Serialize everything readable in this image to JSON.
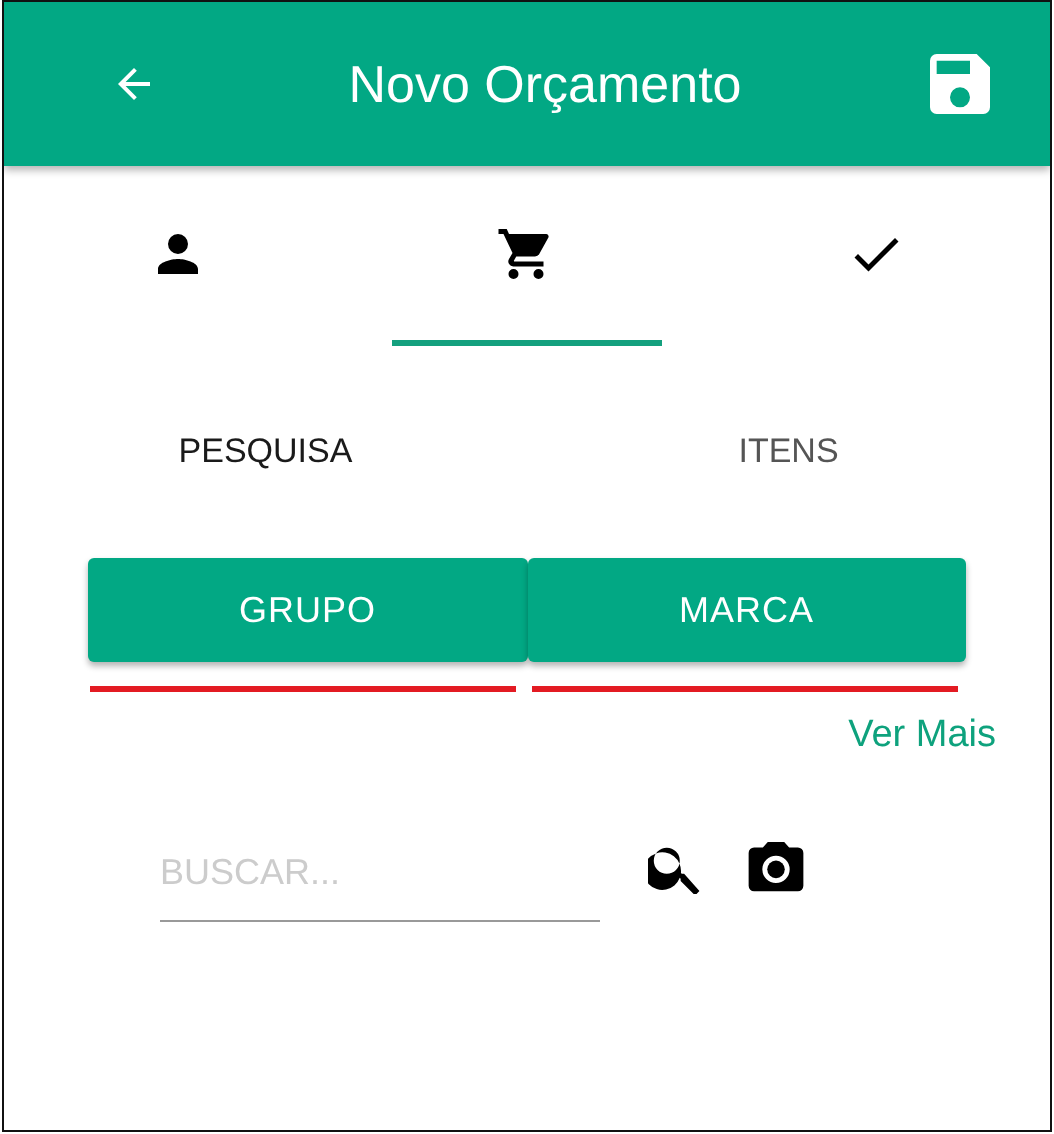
{
  "header": {
    "title": "Novo Orçamento"
  },
  "step_tabs": [
    {
      "kind": "person",
      "selected": false
    },
    {
      "kind": "cart",
      "selected": true
    },
    {
      "kind": "check",
      "selected": false
    }
  ],
  "sub_tabs": [
    {
      "label": "PESQUISA",
      "selected": true
    },
    {
      "label": "ITENS",
      "selected": false
    }
  ],
  "filter_buttons": [
    {
      "label": "GRUPO"
    },
    {
      "label": "MARCA"
    }
  ],
  "more_link": "Ver Mais",
  "search": {
    "placeholder": "BUSCAR..."
  }
}
